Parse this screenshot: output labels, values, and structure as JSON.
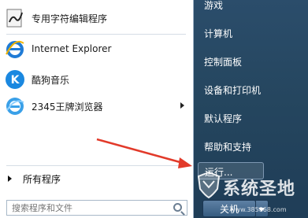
{
  "start_menu": {
    "programs": [
      {
        "label": "专用字符编辑程序",
        "icon": "char-editor-icon"
      },
      {
        "label": "Internet Explorer",
        "icon": "internet-explorer-icon"
      },
      {
        "label": "酷狗音乐",
        "icon": "kugou-music-icon"
      },
      {
        "label": "2345王牌浏览器",
        "icon": "browser-2345-icon"
      }
    ],
    "all_programs_label": "所有程序",
    "search_placeholder": "搜索程序和文件"
  },
  "right_pane": {
    "items": [
      "游戏",
      "计算机",
      "控制面板",
      "设备和打印机",
      "默认程序",
      "帮助和支持",
      "运行..."
    ],
    "shutdown_label": "关机"
  },
  "watermark": {
    "text": "系统圣地",
    "url": "www.385868.com"
  },
  "colors": {
    "arrow": "#e23a2a",
    "right_pane": "#2b4d6b",
    "ie_blue": "#1f7bd6",
    "kugou_blue": "#1a88e0"
  }
}
